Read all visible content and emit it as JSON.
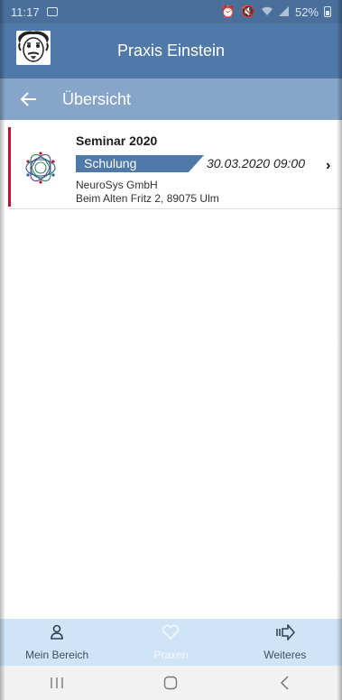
{
  "status_bar": {
    "time": "11:17",
    "battery": "52%"
  },
  "app_bar": {
    "title": "Praxis Einstein",
    "avatar_icon": "einstein-avatar-icon"
  },
  "sub_bar": {
    "back_icon": "arrow-left-icon",
    "title": "Übersicht"
  },
  "events": [
    {
      "title": "Seminar 2020",
      "tag": "Schulung",
      "date": "30.03.2020 09:00",
      "company": "NeuroSys GmbH",
      "address": "Beim Alten Fritz 2, 89075 Ulm",
      "logo_icon": "neurosys-logo-icon",
      "accent_color": "#c8102e"
    }
  ],
  "tabs": [
    {
      "label": "Mein Bereich",
      "icon": "person-icon",
      "active": false
    },
    {
      "label": "Praxen",
      "icon": "heart-icon",
      "active": true
    },
    {
      "label": "Weiteres",
      "icon": "more-arrow-icon",
      "active": false
    }
  ],
  "system_nav": {
    "recent_icon": "recent-apps-icon",
    "home_icon": "home-icon",
    "back_icon": "back-icon"
  },
  "colors": {
    "primary": "#4f79a8",
    "sub_bar": "#86a5c9",
    "accent_red": "#c8102e",
    "tab_bar": "#cfe4f7"
  }
}
